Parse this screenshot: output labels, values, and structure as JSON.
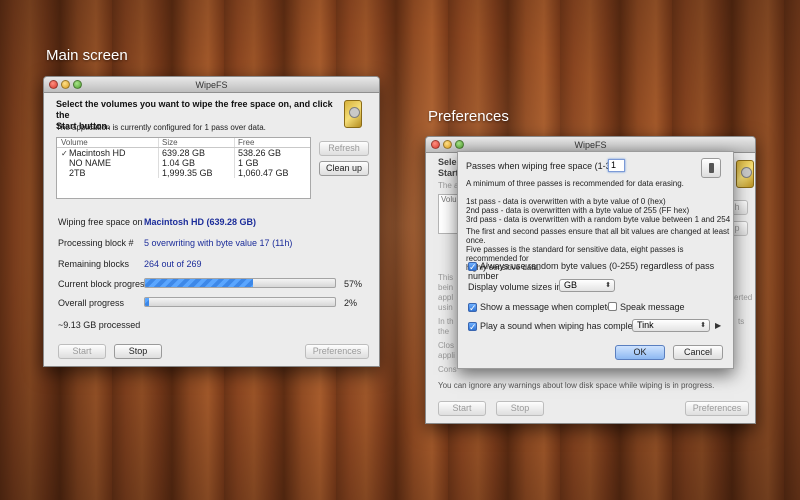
{
  "captions": {
    "main": "Main screen",
    "prefs": "Preferences"
  },
  "main_window": {
    "title": "WipeFS",
    "instruction_line1": "Select the volumes you want to wipe the free space on, and click the",
    "instruction_line2": "Start button.",
    "config_note": "The application is currently configured for 1 pass over data.",
    "table": {
      "headers": [
        "Volume",
        "Size",
        "Free"
      ],
      "rows": [
        {
          "checked": true,
          "volume": "Macintosh HD",
          "size": "639.28 GB",
          "free": "538.26 GB"
        },
        {
          "checked": false,
          "volume": "NO NAME",
          "size": "1.04 GB",
          "free": "1 GB"
        },
        {
          "checked": false,
          "volume": "2TB",
          "size": "1,999.35 GB",
          "free": "1,060.47 GB"
        }
      ]
    },
    "refresh_label": "Refresh",
    "cleanup_label": "Clean up",
    "wiping_label": "Wiping free space on",
    "wiping_value": "Macintosh HD  (639.28 GB)",
    "processing_label": "Processing block #",
    "processing_value": "5 overwriting with byte value 17 (11h)",
    "remaining_label": "Remaining blocks",
    "remaining_value": "264 out of 269",
    "current_progress_label": "Current block progress",
    "current_progress_pct": "57%",
    "current_progress_fraction": 0.57,
    "overall_progress_label": "Overall progress",
    "overall_progress_pct": "2%",
    "overall_progress_fraction": 0.02,
    "processed_label": "~9.13 GB processed",
    "start_label": "Start",
    "stop_label": "Stop",
    "preferences_label": "Preferences"
  },
  "prefs_window": {
    "title": "WipeFS",
    "bg_fragments": {
      "sel": "Sele",
      "star": "Start",
      "th": "The a",
      "vol": "Volu",
      "right_h": "h",
      "right_p": "p",
      "this": "This",
      "bein": "bein",
      "appl": "appl",
      "usin": "usin",
      "erted": "erted",
      "inth": "In th",
      "the": "the",
      "ts": "ts",
      "clos": "Clos",
      "appli": "appli",
      "cons": "Cons",
      "bottom_note": "You can ignore any warnings about low disk space while wiping is in progress."
    },
    "start_label": "Start",
    "stop_label": "Stop",
    "preferences_label": "Preferences",
    "sheet": {
      "passes_label": "Passes when wiping free space (1-35)",
      "passes_value": "1",
      "min_note": "A minimum of three passes is recommended for data erasing.",
      "pass1": "1st pass - data is overwritten with a byte value of 0 (hex)",
      "pass2": "2nd pass - data is overwritten with a byte value of 255 (FF hex)",
      "pass3": "3rd pass - data is overwritten with a random byte value between 1 and 254",
      "para_line1": "The first and second passes ensure that all bit values are changed at least once.",
      "para_line2": "Five passes is the standard for sensitive data, eight passes is recommended for",
      "para_line3": "highly sensitive data.",
      "random_label": "Always use random byte values (0-255) regardless of pass number",
      "random_checked": true,
      "sizes_label": "Display volume sizes in:",
      "sizes_value": "GB",
      "show_msg_label": "Show a message when completed",
      "show_msg_checked": true,
      "speak_label": "Speak message",
      "speak_checked": false,
      "play_sound_label": "Play a sound when wiping has completed",
      "play_sound_checked": true,
      "sound_value": "Tink",
      "ok_label": "OK",
      "cancel_label": "Cancel"
    }
  },
  "icons": {
    "disk": "hard-disk-icon",
    "play": "play-icon",
    "check": "checkmark-icon"
  }
}
